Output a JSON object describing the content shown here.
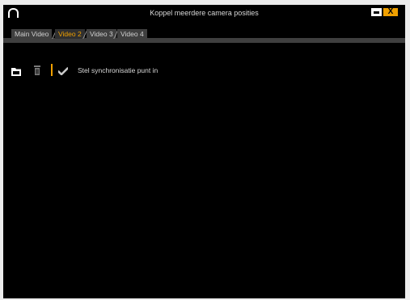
{
  "window": {
    "title": "Koppel meerdere camera posities",
    "logo_icon": "app-logo-arch-icon",
    "maximize_icon": "maximize-icon",
    "close_icon": "close-icon",
    "close_label": "X"
  },
  "tabs": [
    {
      "label": "Main Video",
      "active": false
    },
    {
      "label": "Video 2",
      "active": true
    },
    {
      "label": "Video 3",
      "active": false
    },
    {
      "label": "Video 4",
      "active": false
    }
  ],
  "toolbar": {
    "icons": [
      "folder-icon",
      "trash-icon",
      "checkmark-icon"
    ],
    "sync_label": "Stel synchronisatie punt in"
  },
  "colors": {
    "background": "#000000",
    "accent": "#f0a000",
    "tab_bg": "#3f3f3f",
    "text": "#d8d8d8"
  }
}
